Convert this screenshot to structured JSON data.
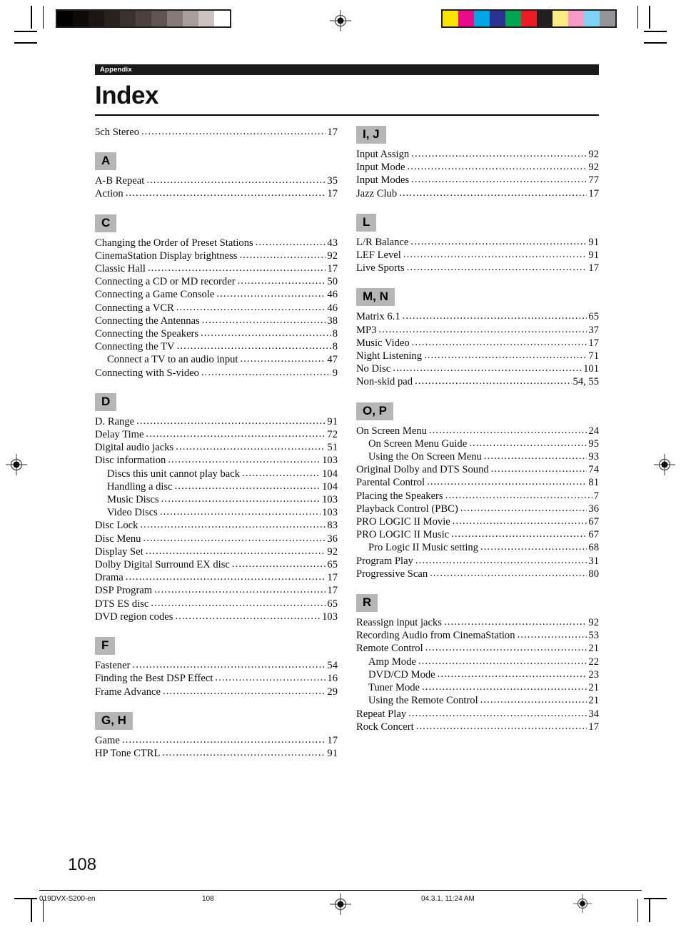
{
  "printer_marks": {
    "gray_bar": {
      "name": "grayscale-calibration-bar",
      "swatches": [
        "#000000",
        "#0d0a0a",
        "#1b1614",
        "#29211e",
        "#3b312d",
        "#4c403c",
        "#61534f",
        "#857a77",
        "#a89e9b",
        "#ccc3c0",
        "#ffffff"
      ]
    },
    "color_bar": {
      "name": "color-calibration-bar",
      "swatches": [
        "#fbe500",
        "#ea0a8c",
        "#00a5e3",
        "#2e3192",
        "#00a651",
        "#ed1c24",
        "#231f20",
        "#fbec84",
        "#f89ac6",
        "#7fd4f5",
        "#939598"
      ]
    }
  },
  "header": {
    "section_label": "Appendix",
    "title": "Index"
  },
  "index": {
    "left_column": [
      {
        "letter": "",
        "entries": [
          {
            "title": "5ch Stereo",
            "page": "17",
            "sub": false
          }
        ]
      },
      {
        "letter": "A",
        "entries": [
          {
            "title": "A-B Repeat",
            "page": "35",
            "sub": false
          },
          {
            "title": "Action",
            "page": "17",
            "sub": false
          }
        ]
      },
      {
        "letter": "C",
        "entries": [
          {
            "title": "Changing the Order of Preset Stations",
            "page": "43",
            "sub": false
          },
          {
            "title": "CinemaStation Display brightness",
            "page": "92",
            "sub": false
          },
          {
            "title": "Classic Hall",
            "page": "17",
            "sub": false
          },
          {
            "title": "Connecting a CD or MD recorder",
            "page": "50",
            "sub": false
          },
          {
            "title": "Connecting a Game Console",
            "page": "46",
            "sub": false
          },
          {
            "title": "Connecting a VCR",
            "page": "46",
            "sub": false
          },
          {
            "title": "Connecting the Antennas",
            "page": "38",
            "sub": false
          },
          {
            "title": "Connecting the Speakers",
            "page": "8",
            "sub": false
          },
          {
            "title": "Connecting the TV",
            "page": "8",
            "sub": false
          },
          {
            "title": "Connect a TV to an audio input",
            "page": "47",
            "sub": true
          },
          {
            "title": "Connecting with S-video",
            "page": "9",
            "sub": false
          }
        ]
      },
      {
        "letter": "D",
        "entries": [
          {
            "title": "D. Range",
            "page": "91",
            "sub": false
          },
          {
            "title": "Delay Time",
            "page": "72",
            "sub": false
          },
          {
            "title": "Digital audio jacks",
            "page": "51",
            "sub": false
          },
          {
            "title": "Disc information",
            "page": "103",
            "sub": false
          },
          {
            "title": "Discs this unit cannot play back",
            "page": "104",
            "sub": true
          },
          {
            "title": "Handling a disc",
            "page": "104",
            "sub": true
          },
          {
            "title": "Music Discs",
            "page": "103",
            "sub": true
          },
          {
            "title": "Video Discs",
            "page": "103",
            "sub": true
          },
          {
            "title": "Disc Lock",
            "page": "83",
            "sub": false
          },
          {
            "title": "Disc Menu",
            "page": "36",
            "sub": false
          },
          {
            "title": "Display Set",
            "page": "92",
            "sub": false
          },
          {
            "title": "Dolby Digital Surround EX disc",
            "page": "65",
            "sub": false
          },
          {
            "title": "Drama",
            "page": "17",
            "sub": false
          },
          {
            "title": "DSP Program",
            "page": "17",
            "sub": false
          },
          {
            "title": "DTS ES disc",
            "page": "65",
            "sub": false
          },
          {
            "title": "DVD region codes",
            "page": "103",
            "sub": false
          }
        ]
      },
      {
        "letter": "F",
        "entries": [
          {
            "title": "Fastener",
            "page": "54",
            "sub": false
          },
          {
            "title": "Finding the Best DSP Effect",
            "page": "16",
            "sub": false
          },
          {
            "title": "Frame Advance",
            "page": "29",
            "sub": false
          }
        ]
      },
      {
        "letter": "G, H",
        "entries": [
          {
            "title": "Game",
            "page": "17",
            "sub": false
          },
          {
            "title": "HP Tone CTRL",
            "page": "91",
            "sub": false
          }
        ]
      }
    ],
    "right_column": [
      {
        "letter": "I, J",
        "entries": [
          {
            "title": "Input Assign",
            "page": "92",
            "sub": false
          },
          {
            "title": "Input Mode",
            "page": "92",
            "sub": false
          },
          {
            "title": "Input Modes",
            "page": "77",
            "sub": false
          },
          {
            "title": "Jazz Club",
            "page": "17",
            "sub": false
          }
        ]
      },
      {
        "letter": "L",
        "entries": [
          {
            "title": "L/R Balance",
            "page": "91",
            "sub": false
          },
          {
            "title": "LEF Level",
            "page": "91",
            "sub": false
          },
          {
            "title": "Live Sports",
            "page": "17",
            "sub": false
          }
        ]
      },
      {
        "letter": "M, N",
        "entries": [
          {
            "title": "Matrix 6.1",
            "page": "65",
            "sub": false
          },
          {
            "title": "MP3",
            "page": "37",
            "sub": false
          },
          {
            "title": "Music Video",
            "page": "17",
            "sub": false
          },
          {
            "title": "Night Listening",
            "page": "71",
            "sub": false
          },
          {
            "title": "No Disc",
            "page": "101",
            "sub": false
          },
          {
            "title": "Non-skid pad",
            "page": "54, 55",
            "sub": false
          }
        ]
      },
      {
        "letter": "O, P",
        "entries": [
          {
            "title": "On Screen Menu",
            "page": "24",
            "sub": false
          },
          {
            "title": "On Screen Menu Guide",
            "page": "95",
            "sub": true
          },
          {
            "title": "Using the On Screen Menu",
            "page": "93",
            "sub": true
          },
          {
            "title": "Original Dolby and DTS Sound",
            "page": "74",
            "sub": false
          },
          {
            "title": "Parental Control",
            "page": "81",
            "sub": false
          },
          {
            "title": "Placing the Speakers",
            "page": "7",
            "sub": false
          },
          {
            "title": "Playback Control (PBC)",
            "page": "36",
            "sub": false
          },
          {
            "title": "PRO LOGIC II Movie",
            "page": "67",
            "sub": false
          },
          {
            "title": "PRO LOGIC II Music",
            "page": "67",
            "sub": false
          },
          {
            "title": "Pro Logic II Music setting",
            "page": "68",
            "sub": true
          },
          {
            "title": "Program Play",
            "page": "31",
            "sub": false
          },
          {
            "title": "Progressive Scan",
            "page": "80",
            "sub": false
          }
        ]
      },
      {
        "letter": "R",
        "entries": [
          {
            "title": "Reassign input jacks",
            "page": "92",
            "sub": false
          },
          {
            "title": "Recording Audio from CinemaStation",
            "page": "53",
            "sub": false
          },
          {
            "title": "Remote Control",
            "page": "21",
            "sub": false
          },
          {
            "title": "Amp Mode",
            "page": "22",
            "sub": true
          },
          {
            "title": "DVD/CD Mode",
            "page": "23",
            "sub": true
          },
          {
            "title": "Tuner Mode",
            "page": "21",
            "sub": true
          },
          {
            "title": "Using the Remote Control",
            "page": "21",
            "sub": true
          },
          {
            "title": "Repeat Play",
            "page": "34",
            "sub": false
          },
          {
            "title": "Rock Concert",
            "page": "17",
            "sub": false
          }
        ]
      }
    ]
  },
  "footer": {
    "folio": "108",
    "file_name": "019DVX-S200-en",
    "page_number": "108",
    "date_time": "04.3.1, 11:24 AM"
  }
}
